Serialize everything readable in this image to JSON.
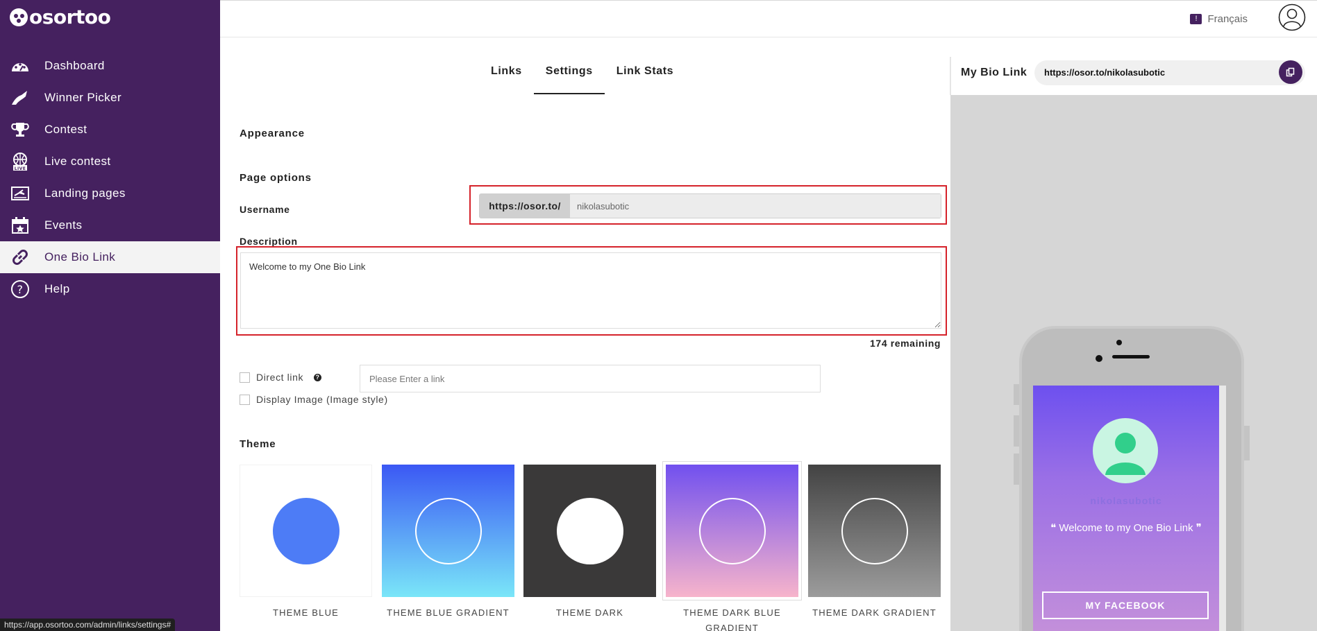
{
  "app": {
    "logo_text": "osortoo",
    "language": "Français"
  },
  "sidebar": {
    "items": [
      {
        "label": "Dashboard",
        "icon": "dashboard-icon"
      },
      {
        "label": "Winner Picker",
        "icon": "winner-picker-icon"
      },
      {
        "label": "Contest",
        "icon": "trophy-icon"
      },
      {
        "label": "Live contest",
        "icon": "live-contest-icon"
      },
      {
        "label": "Landing pages",
        "icon": "landing-page-icon"
      },
      {
        "label": "Events",
        "icon": "calendar-icon"
      },
      {
        "label": "One Bio Link",
        "icon": "link-icon",
        "active": true
      },
      {
        "label": "Help",
        "icon": "help-icon"
      }
    ]
  },
  "tabs": [
    {
      "label": "Links"
    },
    {
      "label": "Settings",
      "active": true
    },
    {
      "label": "Link Stats"
    }
  ],
  "settings": {
    "appearance_title": "Appearance",
    "page_options_title": "Page options",
    "username_label": "Username",
    "username_prefix": "https://osor.to/",
    "username_value": "nikolasubotic",
    "description_label": "Description",
    "description_value": "Welcome to my One Bio Link",
    "remaining_text": "174 remaining",
    "direct_link_label": "Direct link",
    "direct_link_placeholder": "Please Enter a link",
    "display_image_label": "Display Image (Image style)",
    "theme_title": "Theme"
  },
  "themes": [
    {
      "name": "THEME BLUE",
      "colors": [
        "#ffffff",
        "#4d7cf6"
      ]
    },
    {
      "name": "THEME BLUE GRADIENT",
      "colors": [
        "#3b58f4",
        "#7ae6f8"
      ]
    },
    {
      "name": "THEME DARK",
      "colors": [
        "#3a3939",
        "#ffffff"
      ]
    },
    {
      "name": "THEME DARK BLUE GRADIENT",
      "colors": [
        "#7150ef",
        "#f7b4cb"
      ],
      "selected": true
    },
    {
      "name": "THEME DARK GRADIENT",
      "colors": [
        "#434343",
        "#9c9c9c"
      ]
    }
  ],
  "bio_link": {
    "label": "My Bio Link",
    "url": "https://osor.to/nikolasubotic"
  },
  "phone_preview": {
    "username": "nikolasubotic",
    "description": "Welcome to my One Bio Link",
    "button_label": "MY FACEBOOK"
  },
  "status_bar": {
    "url": "https://app.osortoo.com/admin/links/settings#"
  },
  "colors": {
    "brand": "#45215f",
    "highlight": "#d5222a"
  }
}
